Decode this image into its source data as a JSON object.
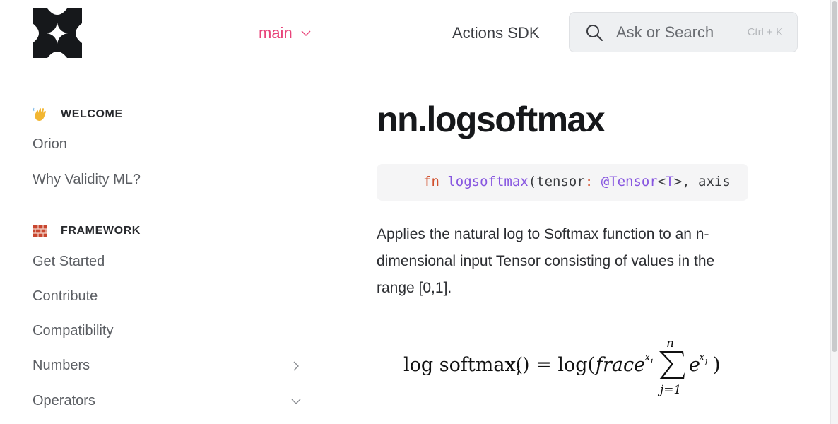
{
  "header": {
    "branch_label": "main",
    "actions_sdk_label": "Actions SDK",
    "search": {
      "placeholder": "Ask or Search",
      "shortcut": "Ctrl + K"
    }
  },
  "sidebar": {
    "sections": [
      {
        "emoji": "waving-hand",
        "title": "WELCOME",
        "items": [
          "Orion",
          "Why Validity ML?"
        ]
      },
      {
        "emoji": "bricks",
        "title": "FRAMEWORK",
        "items": [
          "Get Started",
          "Contribute",
          "Compatibility",
          "Numbers",
          "Operators"
        ]
      }
    ],
    "expandable": {
      "Numbers": "collapsed",
      "Operators": "expanded"
    }
  },
  "main": {
    "title": "nn.logsoftmax",
    "code": {
      "kw": "fn",
      "name": "logsoftmax",
      "open": "(tensor",
      "colon": ":",
      "at_tensor": "@Tensor",
      "lt": "<",
      "T": "T",
      "rest": ">, axis"
    },
    "description": "Applies the natural log to Softmax function to an n-dimensional input Tensor consisting of values in the range [0,1].",
    "formula": {
      "lhs": "log softmax(",
      "x": "x",
      "i": "i",
      "eq": ") = log(",
      "frac": "frace",
      "sum_top": "n",
      "sum_bottom": "j=1",
      "e": "e",
      "xj": "x",
      "j": "j",
      "close": ")"
    }
  },
  "colors": {
    "accent": "#e8447a",
    "keyword": "#d1512f",
    "function": "#8756e0"
  }
}
